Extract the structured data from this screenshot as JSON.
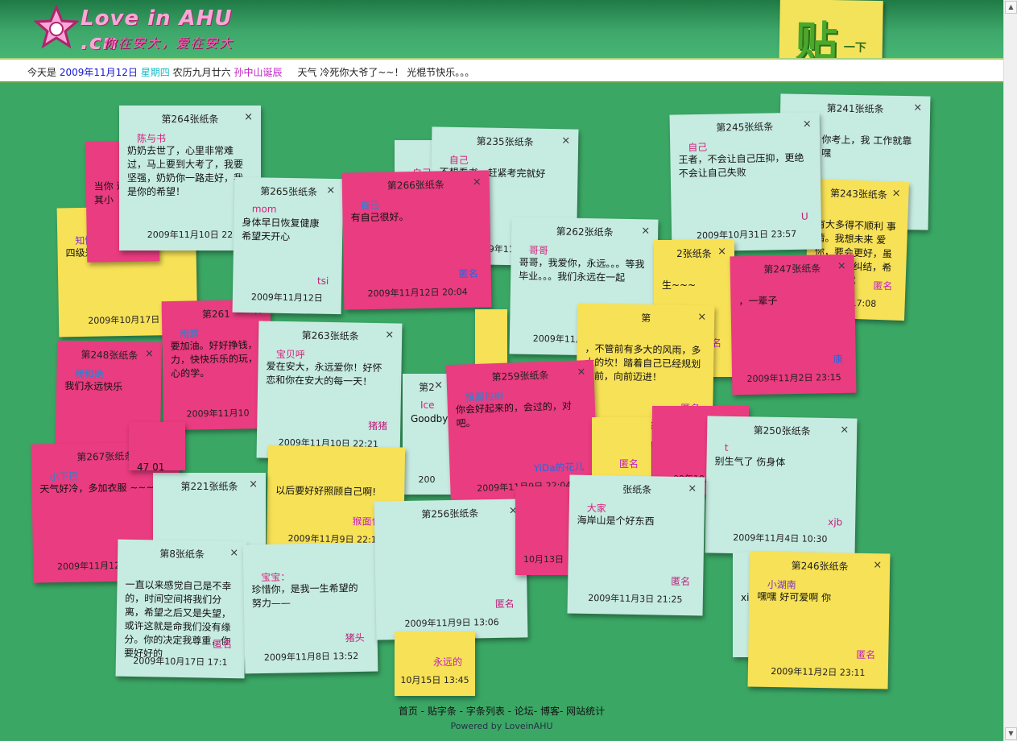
{
  "header": {
    "logo_text": "Love in AHU .cn",
    "logo_subtitle": "你在安大，爱在安大",
    "post_button": {
      "main": "贴",
      "sub": "一下"
    }
  },
  "infobar": {
    "prefix": "今天是",
    "date": "2009年11月12日",
    "weekday": "星期四",
    "lunar": "农历九月廿六",
    "holiday": "孙中山诞辰",
    "weather": "天气 冷死你大爷了~~！ 光棍节快乐。。。"
  },
  "colors": {
    "teal": "#c6ebe1",
    "yellow": "#f7e156",
    "pink": "#ea3c80",
    "background": "#3ba765"
  },
  "notes": [
    {
      "title": "第241张纸条",
      "to": "哥",
      "text": "油啊。。你考上，我 工作就靠你啦。。嘿",
      "from": "",
      "date": "",
      "color": "teal"
    },
    {
      "title": "第243张纸条",
      "to": "",
      "text": "有大多得不顺利 事情。我想未来 爱你，要会更好，虽然现在很纠结，希望 不想就",
      "from": "匿名",
      "date": "9日 17:08",
      "color": "yellow"
    },
    {
      "title": "第23",
      "to": "知情四级考生",
      "text": "四级是机考还是笔试?",
      "from": "",
      "date": "2009年10月17日 1",
      "color": "yellow"
    },
    {
      "title": "",
      "to": "",
      "text": "当你 道这 其小",
      "from": "陈",
      "date": "",
      "color": "pink"
    },
    {
      "title": "第248张纸条",
      "to": "我和她",
      "text": "我们永远快乐",
      "from": "",
      "date": "",
      "color": "pink"
    },
    {
      "title": "第261",
      "to": "雨露",
      "text": "要加油。好好挣钱，力，快快乐乐的玩，心的学。",
      "from": "",
      "date": "2009年11月10",
      "color": "pink"
    },
    {
      "title": "第264张纸条",
      "to": "陈与书",
      "text": "奶奶去世了，心里非常难过，马上要到大考了，我要坚强，奶奶你一路走好，我是你的希望！",
      "from": "陈",
      "date": "2009年11月10日 22",
      "color": "teal"
    },
    {
      "title": "",
      "to": "自己",
      "text": "",
      "from": "",
      "date": "",
      "color": "teal"
    },
    {
      "title": "第235张纸条",
      "to": "自己",
      "text": "不想看书，赶紧考完就好",
      "from": "",
      "date": "2009年11月10",
      "color": "teal"
    },
    {
      "title": "第265张纸条",
      "to": "mom",
      "text": "身体早日恢复健康 希望天开心",
      "from": "tsi",
      "date": "2009年11月12日",
      "color": "teal"
    },
    {
      "title": "第266张纸条",
      "to": "自己",
      "text": "有自己很好。",
      "from": "匿名",
      "date": "2009年11月12日 20:04",
      "color": "pink"
    },
    {
      "title": "",
      "to": "",
      "text": "",
      "from": "匿名",
      "date": "10月29日",
      "color": "yellow"
    },
    {
      "title": "第262张纸条",
      "to": "哥哥",
      "text": "哥哥，我爱你，永远。。。等我毕业。。。我们永远在一起",
      "from": "小傻瓜",
      "date": "2009年11月10日 17:32",
      "color": "teal"
    },
    {
      "title": "第245张纸条",
      "to": "自己",
      "text": "王者，不会让自己压抑，更绝不会让自己失败",
      "from": "U",
      "date": "2009年10月31日 23:57",
      "color": "teal"
    },
    {
      "title": "2张纸条",
      "to": "",
      "text": "生~~~",
      "from": "匿名",
      "date": "11",
      "color": "yellow"
    },
    {
      "title": "第247张纸条",
      "to": "",
      "text": "，一辈子",
      "from": "康",
      "date": "2009年11月2日 23:15",
      "color": "pink"
    },
    {
      "title": "第",
      "to": "",
      "text": "，不管前有多大的风雨，多大的坎！踏着自己已经规划的前，向前迈进！",
      "from": "匿名",
      "date": "2009年11月9日 17:53",
      "color": "yellow"
    },
    {
      "title": "第263张纸条",
      "to": "宝贝呼",
      "text": "爱在安大，永远爱你！好怀恋和你在安大的每一天！",
      "from": "猪猪",
      "date": "2009年11月10日 22:21",
      "color": "teal"
    },
    {
      "title": "第2",
      "to": "Ice",
      "text": "Goodbye",
      "from": "",
      "date": "200",
      "color": "teal"
    },
    {
      "title": "第259张纸条",
      "to": "猴面包树",
      "text": "你会好起来的，会过的，对吧。",
      "from": "YiDa的花儿",
      "date": "2009年11月9日 22:04",
      "color": "pink"
    },
    {
      "title": "",
      "to": "",
      "text": "",
      "from": "匿名",
      "date": "4日 23:16",
      "color": "yellow"
    },
    {
      "title": "",
      "to": "",
      "text": "",
      "from": "",
      "date": "09年10月4日",
      "color": "pink"
    },
    {
      "title": "第250张纸条",
      "to": "t",
      "text": "别生气了 伤身体",
      "from": "xjb",
      "date": "2009年11月4日 10:30",
      "color": "teal"
    },
    {
      "title": "第267张纸条",
      "to": "小下巴",
      "text": "天气好冷，多加衣服 ~~~",
      "from": "下小巴",
      "date": "2009年11月12日 21:34",
      "color": "pink"
    },
    {
      "title": "",
      "to": "",
      "text": "以后要好好照顾自己啊!",
      "from": "猴面包树",
      "date": "2009年11月9日 22:13",
      "color": "yellow"
    },
    {
      "title": "第221张纸条",
      "to": "",
      "text": "",
      "from": "",
      "date": "",
      "color": "teal"
    },
    {
      "title": "第8张纸条",
      "to": "",
      "text": "一直以来感觉自己是不幸的，时间空间将我们分离，希望之后又是失望，或许这就是命我们没有缘分。你的决定我尊重，你要好好的",
      "from": "匿名",
      "date": "2009年10月17日 17:1",
      "color": "teal"
    },
    {
      "title": "",
      "to": "宝宝：",
      "text": "珍惜你，是我一生希望的努力——",
      "from": "猪头",
      "date": "2009年11月8日 13:52",
      "color": "teal"
    },
    {
      "title": "第256张纸条",
      "to": "",
      "text": "",
      "from": "匿名",
      "date": "2009年11月9日 13:06",
      "color": "teal"
    },
    {
      "title": "",
      "to": "",
      "text": "",
      "from": "",
      "date": "10月13日",
      "color": "pink"
    },
    {
      "title": "",
      "to": "",
      "text": "",
      "from": "永远的",
      "date": "10月15日 13:45",
      "color": "yellow"
    },
    {
      "title": "张纸条",
      "to": "大家",
      "text": "海岸山是个好东西",
      "from": "匿名",
      "date": "2009年11月3日 21:25",
      "color": "teal"
    },
    {
      "title": "",
      "to": "",
      "text": "xi",
      "from": "",
      "date": "",
      "color": "teal"
    },
    {
      "title": "第246张纸条",
      "to": "小湖南",
      "text": "嘿嘿 好可爱啊 你",
      "from": "匿名",
      "date": "2009年11月2日 23:11",
      "color": "yellow"
    },
    {
      "title": "",
      "to": "",
      "text": "47 01",
      "from": "",
      "date": "",
      "color": "pink"
    }
  ],
  "footer": {
    "links": [
      "首页",
      "贴字条",
      "字条列表",
      "论坛",
      "博客",
      "网站统计"
    ],
    "powered": "Powered by LoveinAHU"
  }
}
